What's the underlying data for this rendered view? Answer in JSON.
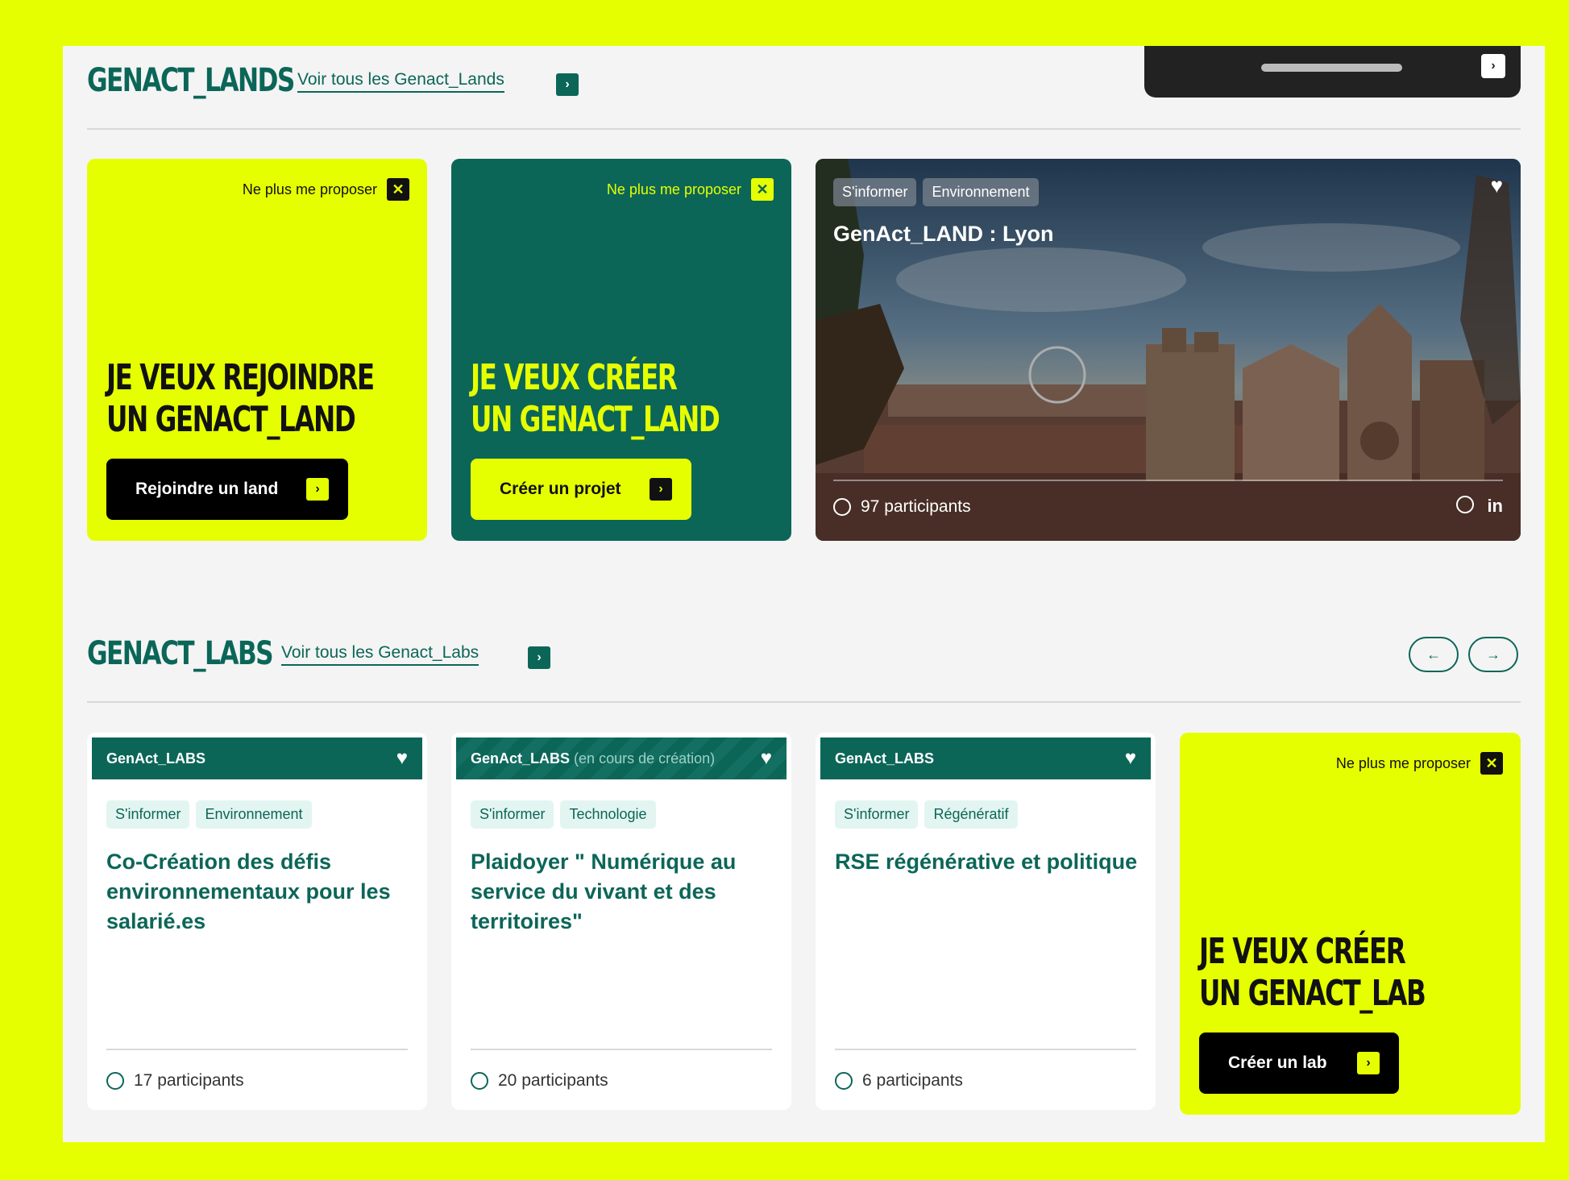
{
  "lands_section": {
    "title": "GENACT_LANDS",
    "see_all": "Voir tous les Genact_Lands"
  },
  "labs_section": {
    "title": "GENACT_LABS",
    "see_all": "Voir tous les Genact_Labs",
    "prev_label": "←",
    "next_label": "→"
  },
  "dismiss_label": "Ne plus me proposer",
  "join_land_card": {
    "line1": "JE VEUX REJOINDRE",
    "line2": "UN GENACT_LAND",
    "cta": "Rejoindre un land"
  },
  "create_land_card": {
    "line1": "JE VEUX CRÉER",
    "line2": "UN GENACT_LAND",
    "cta": "Créer un projet"
  },
  "lyon_card": {
    "tags": [
      "S'informer",
      "Environnement"
    ],
    "title": "GenAct_LAND : Lyon",
    "participants": "97 participants",
    "share_linkedin": "in"
  },
  "labs": [
    {
      "type": "GenAct_LABS",
      "status": "",
      "tags": [
        "S'informer",
        "Environnement"
      ],
      "title": "Co-Création des défis environnementaux pour les salarié.es",
      "participants": "17 participants"
    },
    {
      "type": "GenAct_LABS",
      "status": "(en cours de création)",
      "tags": [
        "S'informer",
        "Technologie"
      ],
      "title": "Plaidoyer \" Numérique au service du vivant et des territoires\"",
      "participants": "20 participants"
    },
    {
      "type": "GenAct_LABS",
      "status": "",
      "tags": [
        "S'informer",
        "Régénératif"
      ],
      "title": "RSE régénérative et politique",
      "participants": "6 participants"
    }
  ],
  "create_lab_card": {
    "line1": "JE VEUX CRÉER",
    "line2": "UN GENACT_LAB",
    "cta": "Créer un lab"
  },
  "colors": {
    "lime": "#e6ff00",
    "teal": "#0b6658",
    "page_bg": "#f4f4f4"
  }
}
